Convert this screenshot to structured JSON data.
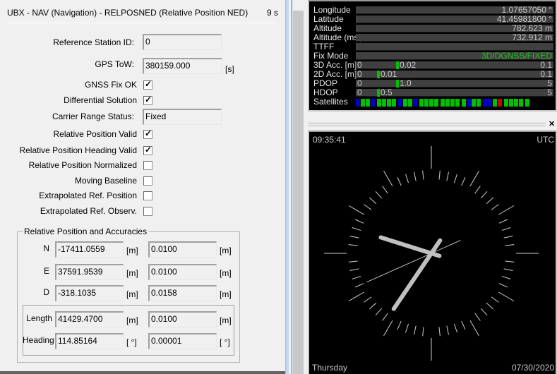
{
  "header": {
    "title": "UBX - NAV (Navigation) - RELPOSNED (Relative Position NED)",
    "age": "9 s"
  },
  "fields": {
    "ref_station_label": "Reference Station ID:",
    "ref_station_value": "0",
    "gps_tow_label": "GPS ToW:",
    "gps_tow_value": "380159.000",
    "gps_tow_unit": "[s]",
    "carrier_label": "Carrier Range Status:",
    "carrier_value": "Fixed"
  },
  "flags": [
    {
      "label": "GNSS Fix OK",
      "checked": true
    },
    {
      "label": "Differential Solution",
      "checked": true
    },
    {
      "label": "Relative Position Valid",
      "checked": true
    },
    {
      "label": "Relative Position Heading Valid",
      "checked": true
    },
    {
      "label": "Relative Position Normalized",
      "checked": false
    },
    {
      "label": "Moving Baseline",
      "checked": false
    },
    {
      "label": "Extrapolated Ref. Position",
      "checked": false
    },
    {
      "label": "Extrapolated Ref. Observ.",
      "checked": false
    }
  ],
  "relpos": {
    "group_title": "Relative Position and Accuracies",
    "rows": [
      {
        "label": "N",
        "value": "-17411.0559",
        "unit": "[m]",
        "acc": "0.0100",
        "acc_unit": "[m]"
      },
      {
        "label": "E",
        "value": "37591.9539",
        "unit": "[m]",
        "acc": "0.0100",
        "acc_unit": "[m]"
      },
      {
        "label": "D",
        "value": "-318.1035",
        "unit": "[m]",
        "acc": "0.0158",
        "acc_unit": "[m]"
      },
      {
        "label": "Length",
        "value": "41429.4700",
        "unit": "[m]",
        "acc": "0.0100",
        "acc_unit": "[m]"
      },
      {
        "label": "Heading",
        "value": "114.85164",
        "unit": "[ °]",
        "acc": "0.00001",
        "acc_unit": "[ °]"
      }
    ]
  },
  "gps": {
    "rows": [
      {
        "label": "Longitude",
        "value": "1.07657050 °"
      },
      {
        "label": "Latitude",
        "value": "41.45981800 °"
      },
      {
        "label": "Altitude",
        "value": "782.623 m"
      },
      {
        "label": "Altitude (msl)",
        "value": "732.912 m"
      },
      {
        "label": "TTFF",
        "value": ""
      },
      {
        "label": "Fix Mode",
        "value": "3D/DGNSS/FIXED"
      }
    ],
    "fix_color": "#20c020",
    "bars": [
      {
        "label": "3D Acc. [m]",
        "min": "0",
        "max": "0.1",
        "value_text": "0.02",
        "fraction": 0.2
      },
      {
        "label": "2D Acc. [m]",
        "min": "0",
        "max": "0.1",
        "value_text": "0.01",
        "fraction": 0.1
      },
      {
        "label": "PDOP",
        "min": "0",
        "max": "5",
        "value_text": "1.0",
        "fraction": 0.2
      },
      {
        "label": "HDOP",
        "min": "0",
        "max": "5",
        "value_text": "0.5",
        "fraction": 0.1
      }
    ],
    "satellites_label": "Satellites",
    "satellites": [
      "B",
      "G",
      "G",
      "B",
      "G",
      "G",
      "G",
      "G",
      "B",
      "G",
      "G",
      "B",
      "G",
      "G",
      "G",
      "G",
      "G",
      "G",
      "G",
      "G",
      "G",
      "B",
      "G",
      "G",
      "B",
      "B",
      "G",
      "R",
      "G",
      "G",
      "G",
      "G",
      "G"
    ],
    "sat_colors": {
      "B": "#0000c8",
      "G": "#00c000",
      "R": "#c80000"
    }
  },
  "clock": {
    "time": "09:35:41",
    "timezone": "UTC",
    "day": "Thursday",
    "date": "07/30/2020",
    "hour": 9,
    "minute": 35,
    "second": 41
  }
}
